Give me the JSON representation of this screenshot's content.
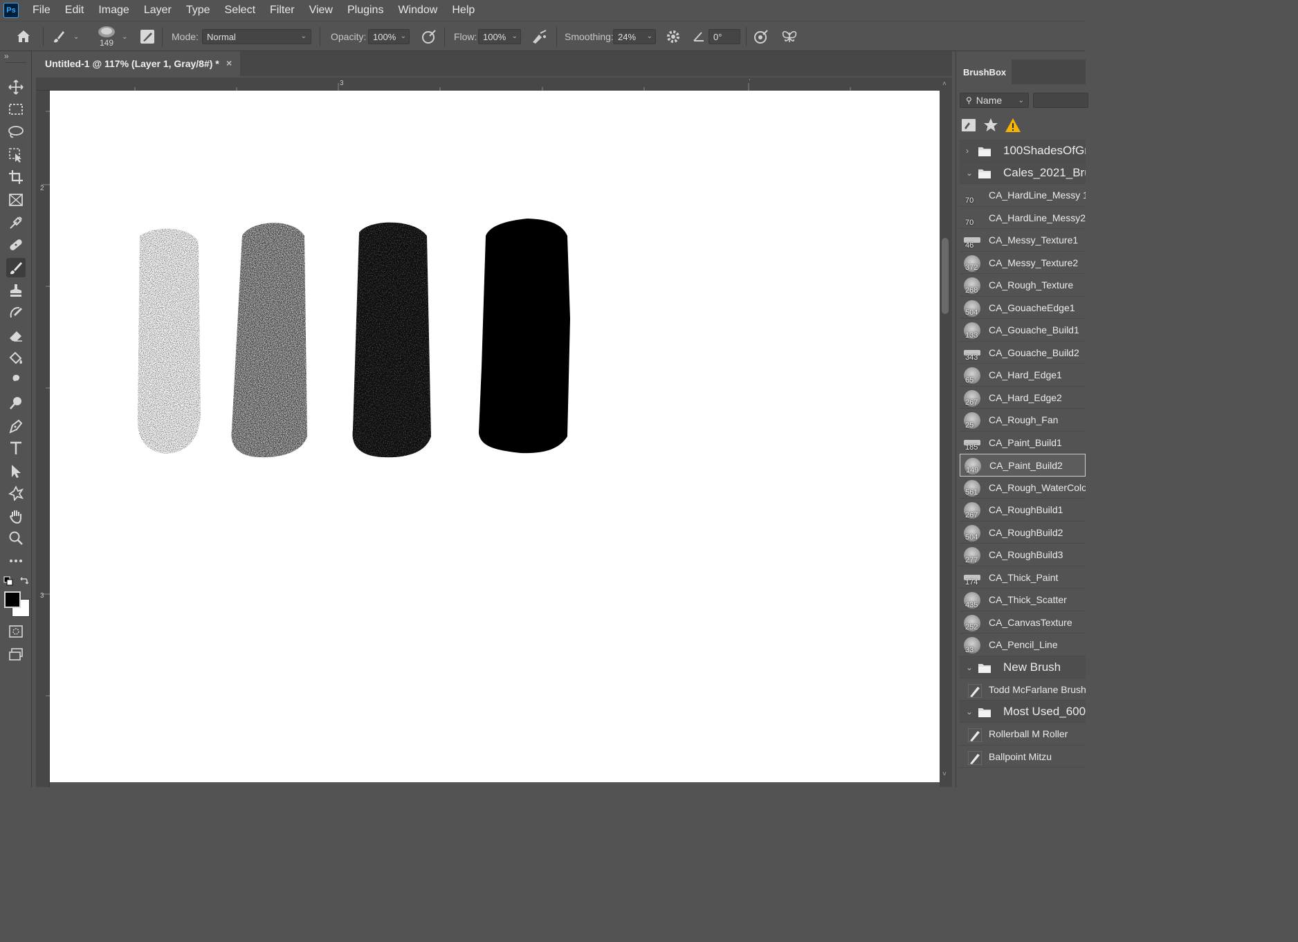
{
  "app": {
    "logo": "Ps"
  },
  "menu": [
    "File",
    "Edit",
    "Image",
    "Layer",
    "Type",
    "Select",
    "Filter",
    "View",
    "Plugins",
    "Window",
    "Help"
  ],
  "options": {
    "brush_size": "149",
    "mode_label": "Mode:",
    "mode_value": "Normal",
    "opacity_label": "Opacity:",
    "opacity_value": "100%",
    "flow_label": "Flow:",
    "flow_value": "100%",
    "smoothing_label": "Smoothing:",
    "smoothing_value": "24%",
    "angle_value": "0°"
  },
  "document": {
    "tab_title": "Untitled-1 @ 117% (Layer 1, Gray/8#) *",
    "close": "×"
  },
  "rulers": {
    "top_labels": [
      "3"
    ],
    "left_labels": [
      "2",
      "3"
    ]
  },
  "colors": {
    "foreground": "#000000",
    "background": "#ffffff"
  },
  "panel": {
    "tab": "BrushBox",
    "sort_label": "Name",
    "folders": [
      {
        "name": "100ShadesOfGr",
        "expanded": false,
        "brushes": []
      },
      {
        "name": "Cales_2021_Bru",
        "expanded": true,
        "brushes": [
          {
            "name": "CA_HardLine_Messy 1",
            "size": "70",
            "thumb": "none"
          },
          {
            "name": "CA_HardLine_Messy2",
            "size": "70",
            "thumb": "none"
          },
          {
            "name": "CA_Messy_Texture1",
            "size": "46",
            "thumb": "flat"
          },
          {
            "name": "CA_Messy_Texture2",
            "size": "372",
            "thumb": "round"
          },
          {
            "name": "CA_Rough_Texture",
            "size": "268",
            "thumb": "round"
          },
          {
            "name": "CA_GouacheEdge1",
            "size": "504",
            "thumb": "round"
          },
          {
            "name": "CA_Gouache_Build1",
            "size": "133",
            "thumb": "round"
          },
          {
            "name": "CA_Gouache_Build2",
            "size": "343",
            "thumb": "flat"
          },
          {
            "name": "CA_Hard_Edge1",
            "size": "65",
            "thumb": "round"
          },
          {
            "name": "CA_Hard_Edge2",
            "size": "267",
            "thumb": "round"
          },
          {
            "name": "CA_Rough_Fan",
            "size": "25",
            "thumb": "round"
          },
          {
            "name": "CA_Paint_Build1",
            "size": "185",
            "thumb": "flat"
          },
          {
            "name": "CA_Paint_Build2",
            "size": "149",
            "thumb": "round",
            "selected": true
          },
          {
            "name": "CA_Rough_WaterColou",
            "size": "561",
            "thumb": "round"
          },
          {
            "name": "CA_RoughBuild1",
            "size": "267",
            "thumb": "round"
          },
          {
            "name": "CA_RoughBuild2",
            "size": "504",
            "thumb": "round"
          },
          {
            "name": "CA_RoughBuild3",
            "size": "277",
            "thumb": "round"
          },
          {
            "name": "CA_Thick_Paint",
            "size": "174",
            "thumb": "flat"
          },
          {
            "name": "CA_Thick_Scatter",
            "size": "435",
            "thumb": "round"
          },
          {
            "name": "CA_CanvasTexture",
            "size": "252",
            "thumb": "round"
          },
          {
            "name": "CA_Pencil_Line",
            "size": "33",
            "thumb": "round"
          }
        ]
      },
      {
        "name": "New Brush",
        "expanded": true,
        "brushes": [
          {
            "name": "Todd McFarlane Brush",
            "size": "",
            "thumb": "pen"
          }
        ]
      },
      {
        "name": "Most Used_600",
        "expanded": true,
        "brushes": [
          {
            "name": "Rollerball M Roller",
            "size": "",
            "thumb": "pen"
          },
          {
            "name": "Ballpoint Mitzu",
            "size": "",
            "thumb": "pen"
          }
        ]
      }
    ]
  },
  "tools": [
    "move-tool",
    "marquee-tool",
    "lasso-tool",
    "object-select-tool",
    "crop-tool",
    "frame-tool",
    "eyedropper-tool",
    "healing-tool",
    "brush-tool",
    "stamp-tool",
    "history-brush-tool",
    "eraser-tool",
    "paint-bucket-tool",
    "smudge-tool",
    "dodge-tool",
    "pen-tool",
    "type-tool",
    "path-select-tool",
    "shape-tool",
    "hand-tool",
    "zoom-tool",
    "more-tools"
  ]
}
